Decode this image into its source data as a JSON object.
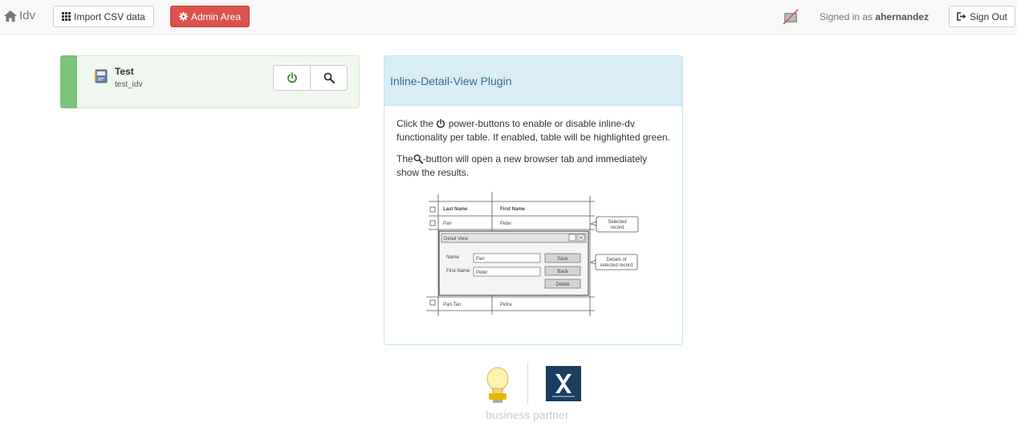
{
  "navbar": {
    "brand": "Idv",
    "import_label": "Import CSV data",
    "admin_label": "Admin Area",
    "signed_in_prefix": "Signed in as",
    "username": "ahernandez",
    "signout_label": "Sign Out"
  },
  "tile": {
    "title": "Test",
    "subtitle": "test_idv",
    "accent_color": "#7bc47a"
  },
  "panel": {
    "heading": "Inline-Detail-View Plugin",
    "para1_before": "Click the",
    "para1_after": "power-buttons to enable or disable inline-dv functionality per table. If enabled, table will be highlighted green.",
    "para2_before": "The",
    "para2_after": "-button will open a new browser tab and immediately show the results."
  },
  "mockup": {
    "col_last": "Last Name",
    "col_first": "First Name",
    "row1_last": "Pan",
    "row1_first": "Peter",
    "callout_selected": [
      "Selected",
      "record"
    ],
    "dialog_title": "Detail View",
    "name_label": "Name",
    "name_value": "Pan",
    "first_label": "First Name",
    "first_value": "Peter",
    "save": "Save",
    "back": "Back",
    "delete": "Delete",
    "callout_details": [
      "Details of",
      "selected record"
    ],
    "row3_last": "Pan-Tan",
    "row3_first": "Petra"
  },
  "footer": {
    "tagline": "business partner"
  }
}
